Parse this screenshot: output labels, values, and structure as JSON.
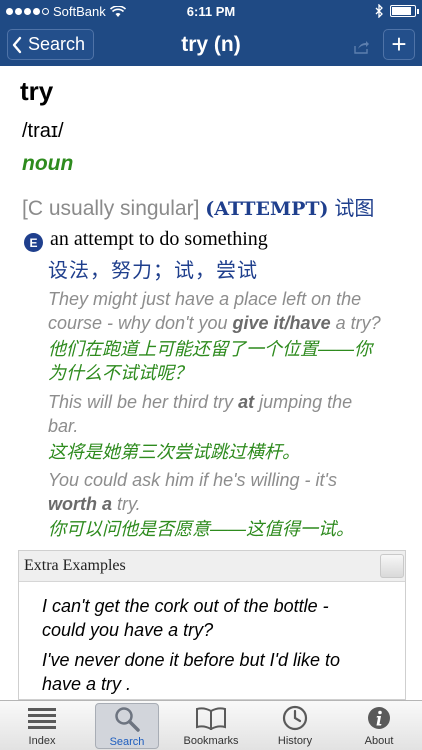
{
  "status": {
    "carrier": "SoftBank",
    "time": "6:11 PM",
    "battery_level": 0.85
  },
  "nav": {
    "back_label": "Search",
    "title": "try (n)",
    "add_label": "+"
  },
  "entry": {
    "headword": "try",
    "pronunciation": "/traɪ/",
    "pos": "noun",
    "grammar": "[C usually singular]",
    "sense_label": "(ATTEMPT)",
    "sense_zh": "试图",
    "e_badge": "E",
    "definition": "an attempt to do something",
    "definition_zh": "设法，努力；试，尝试",
    "examples": [
      {
        "en_1": "They might just have a place left on the",
        "en_2a": "course - why don't you ",
        "en_b": "give it/have",
        "en_2c": " a try?",
        "zh_1": "他们在跑道上可能还留了一个位置——你",
        "zh_2": "为什么不试试呢？"
      },
      {
        "en_1a": "This will be her third try ",
        "en_b": "at",
        "en_1c": " jumping the",
        "en_2": "bar.",
        "zh_1": "这将是她第三次尝试跳过横杆。"
      },
      {
        "en_1": "You could ask him if he's willing - it's",
        "en_b": "worth a",
        "en_2c": " try.",
        "zh_1": "你可以问他是否愿意——这值得一试。"
      }
    ]
  },
  "extra": {
    "title": "Extra Examples",
    "items": [
      {
        "line1": "I can't get the cork out of the bottle -",
        "line2": "could you have a try?"
      },
      {
        "line1": "I've never done it before but I'd like to",
        "line2": "have a try ."
      }
    ]
  },
  "tabs": [
    {
      "label": "Index",
      "icon": "list-icon"
    },
    {
      "label": "Search",
      "icon": "search-icon",
      "active": true
    },
    {
      "label": "Bookmarks",
      "icon": "book-icon"
    },
    {
      "label": "History",
      "icon": "clock-icon"
    },
    {
      "label": "About",
      "icon": "info-icon"
    }
  ]
}
